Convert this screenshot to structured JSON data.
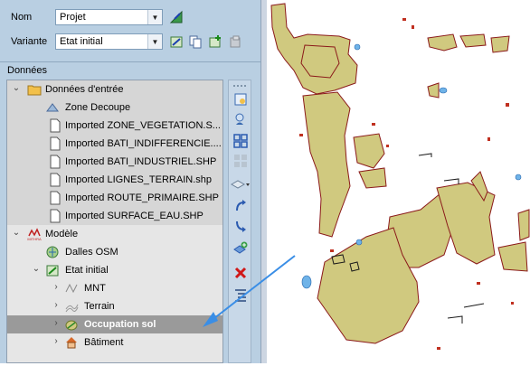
{
  "form": {
    "nom_label": "Nom",
    "nom_value": "Projet",
    "variante_label": "Variante",
    "variante_value": "Etat initial"
  },
  "section_title": "Données",
  "tree": {
    "items": [
      {
        "label": "Données d'entrée",
        "icon": "folder-icon"
      },
      {
        "label": "Zone Decoupe",
        "icon": "zone-layer-icon"
      },
      {
        "label": "Imported ZONE_VEGETATION.S...",
        "icon": "document-icon"
      },
      {
        "label": "Imported BATI_INDIFFERENCIE....",
        "icon": "document-icon"
      },
      {
        "label": "Imported BATI_INDUSTRIEL.SHP",
        "icon": "document-icon"
      },
      {
        "label": "Imported LIGNES_TERRAIN.shp",
        "icon": "document-icon"
      },
      {
        "label": "Imported ROUTE_PRIMAIRE.SHP",
        "icon": "document-icon"
      },
      {
        "label": "Imported SURFACE_EAU.SHP",
        "icon": "document-icon"
      },
      {
        "label": "Modèle",
        "icon": "mithra-logo-icon",
        "logo_text": "MITHRA"
      },
      {
        "label": "Dalles OSM",
        "icon": "osm-tiles-icon"
      },
      {
        "label": "Etat initial",
        "icon": "variant-icon"
      },
      {
        "label": "MNT",
        "icon": "mnt-layer-icon"
      },
      {
        "label": "Terrain",
        "icon": "terrain-icon"
      },
      {
        "label": "Occupation sol",
        "icon": "land-use-icon"
      },
      {
        "label": "Bâtiment",
        "icon": "building-icon"
      }
    ]
  },
  "colors": {
    "panel": "#b9cfe2",
    "land_fill": "#d0c97f",
    "land_stroke": "#8b1a1a",
    "water": "#6fb3e8",
    "arrow": "#3a8ee6"
  }
}
